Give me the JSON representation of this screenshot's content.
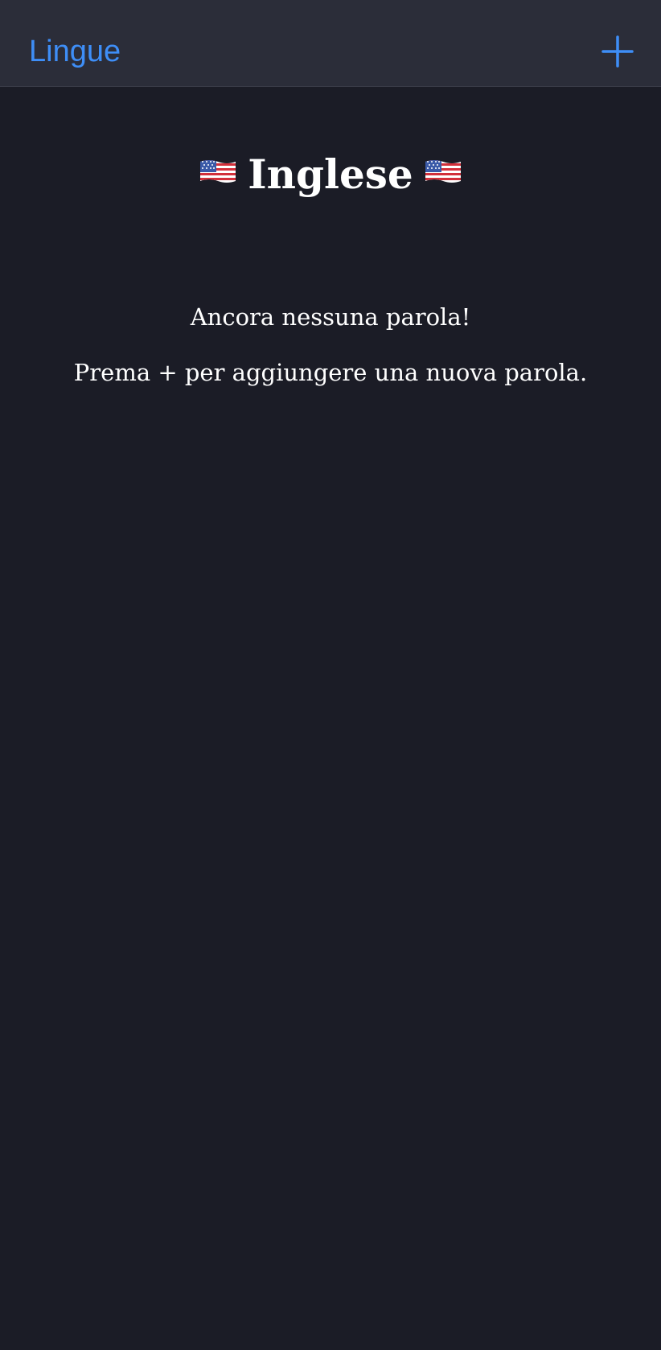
{
  "nav": {
    "back_label": "Lingue",
    "add_icon": "plus-icon",
    "accent_color": "#3e8ef7"
  },
  "header": {
    "title": "Inglese",
    "flag_icon": "us-flag-icon"
  },
  "empty_state": {
    "heading": "Ancora nessuna parola!",
    "hint": "Prema + per aggiungere una nuova parola."
  },
  "colors": {
    "background": "#1b1c26",
    "nav_background": "#2b2d39",
    "text": "#ffffff"
  }
}
